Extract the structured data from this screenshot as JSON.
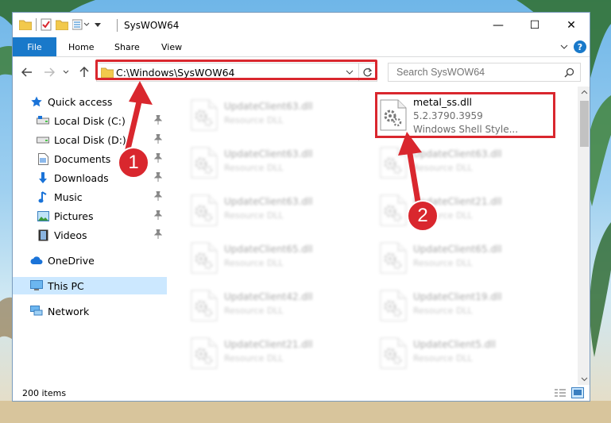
{
  "window": {
    "title": "SysWOW64",
    "minimize": "—",
    "maximize": "☐",
    "close": "✕",
    "help": "?"
  },
  "ribbon": {
    "tabs": [
      {
        "label": "File"
      },
      {
        "label": "Home"
      },
      {
        "label": "Share"
      },
      {
        "label": "View"
      }
    ]
  },
  "address": {
    "path": "C:\\Windows\\SysWOW64",
    "search_placeholder": "Search SysWOW64"
  },
  "nav": {
    "items": [
      {
        "label": "Quick access",
        "icon": "star-icon"
      },
      {
        "label": "Local Disk (C:)",
        "icon": "drive-icon",
        "pinned": true
      },
      {
        "label": "Local Disk (D:)",
        "icon": "drive-icon",
        "pinned": true
      },
      {
        "label": "Documents",
        "icon": "documents-icon",
        "pinned": true
      },
      {
        "label": "Downloads",
        "icon": "download-icon",
        "pinned": true
      },
      {
        "label": "Music",
        "icon": "music-icon",
        "pinned": true
      },
      {
        "label": "Pictures",
        "icon": "pictures-icon",
        "pinned": true
      },
      {
        "label": "Videos",
        "icon": "videos-icon",
        "pinned": true
      },
      {
        "label": "OneDrive",
        "icon": "cloud-icon"
      },
      {
        "label": "This PC",
        "icon": "computer-icon",
        "selected": true
      },
      {
        "label": "Network",
        "icon": "network-icon"
      }
    ]
  },
  "files": {
    "left": [
      {
        "name": "UpdateClient63.dll",
        "type": "Resource DLL"
      },
      {
        "name": "UpdateClient63.dll",
        "type": "Resource DLL"
      },
      {
        "name": "UpdateClient63.dll",
        "type": "Resource DLL"
      },
      {
        "name": "UpdateClient65.dll",
        "type": "Resource DLL"
      },
      {
        "name": "UpdateClient42.dll",
        "type": "Resource DLL"
      },
      {
        "name": "UpdateClient21.dll",
        "type": "Resource DLL"
      }
    ],
    "right": [
      {
        "name": "metal_ss.dll",
        "version": "5.2.3790.3959",
        "type": "Windows Shell Style..."
      },
      {
        "name": "UpdateClient63.dll",
        "type": "Resource DLL"
      },
      {
        "name": "UpdateClient21.dll",
        "type": "Resource DLL"
      },
      {
        "name": "UpdateClient65.dll",
        "type": "Resource DLL"
      },
      {
        "name": "UpdateClient19.dll",
        "type": "Resource DLL"
      },
      {
        "name": "UpdateClient5.dll",
        "type": "Resource DLL"
      }
    ]
  },
  "status": {
    "count": "200 items"
  },
  "callouts": {
    "one": "1",
    "two": "2"
  },
  "colors": {
    "accent": "#1979ca",
    "highlight": "#d9272e",
    "selected": "#cce8ff"
  }
}
